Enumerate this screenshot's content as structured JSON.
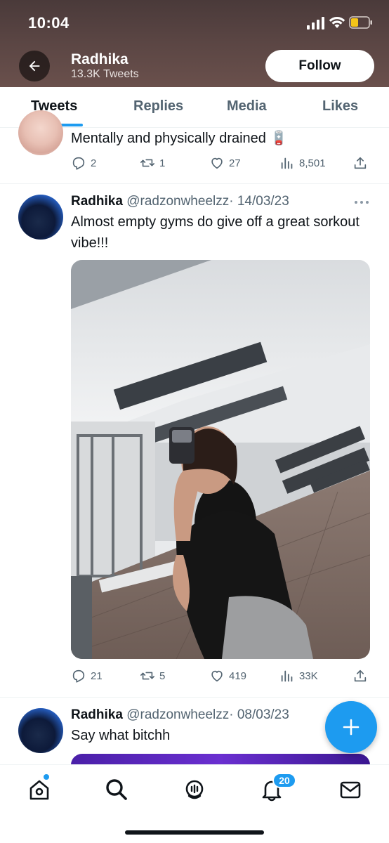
{
  "status_bar": {
    "time": "10:04"
  },
  "header": {
    "name": "Radhika",
    "tweet_count": "13.3K Tweets",
    "follow_label": "Follow"
  },
  "tabs": [
    {
      "label": "Tweets",
      "active": true
    },
    {
      "label": "Replies",
      "active": false
    },
    {
      "label": "Media",
      "active": false
    },
    {
      "label": "Likes",
      "active": false
    }
  ],
  "tweets": [
    {
      "text": "Mentally and physically drained 🪫",
      "replies": "2",
      "retweets": "1",
      "likes": "27",
      "views": "8,501"
    },
    {
      "name": "Radhika",
      "handle": "@radzonwheelzz",
      "date": "· 14/03/23",
      "text": "Almost empty gyms do give off a great sorkout vibe!!!",
      "replies": "21",
      "retweets": "5",
      "likes": "419",
      "views": "33K"
    },
    {
      "name": "Radhika",
      "handle": "@radzonwheelzz",
      "date": "· 08/03/23",
      "text": "Say what bitchh"
    }
  ],
  "bottom_nav": {
    "items": [
      "home-icon",
      "search-icon",
      "spaces-icon",
      "notifications-icon",
      "messages-icon"
    ],
    "notification_badge": "20"
  },
  "colors": {
    "accent": "#1d9bf0",
    "header_bg": "#5b4644",
    "text_secondary": "#536471"
  }
}
